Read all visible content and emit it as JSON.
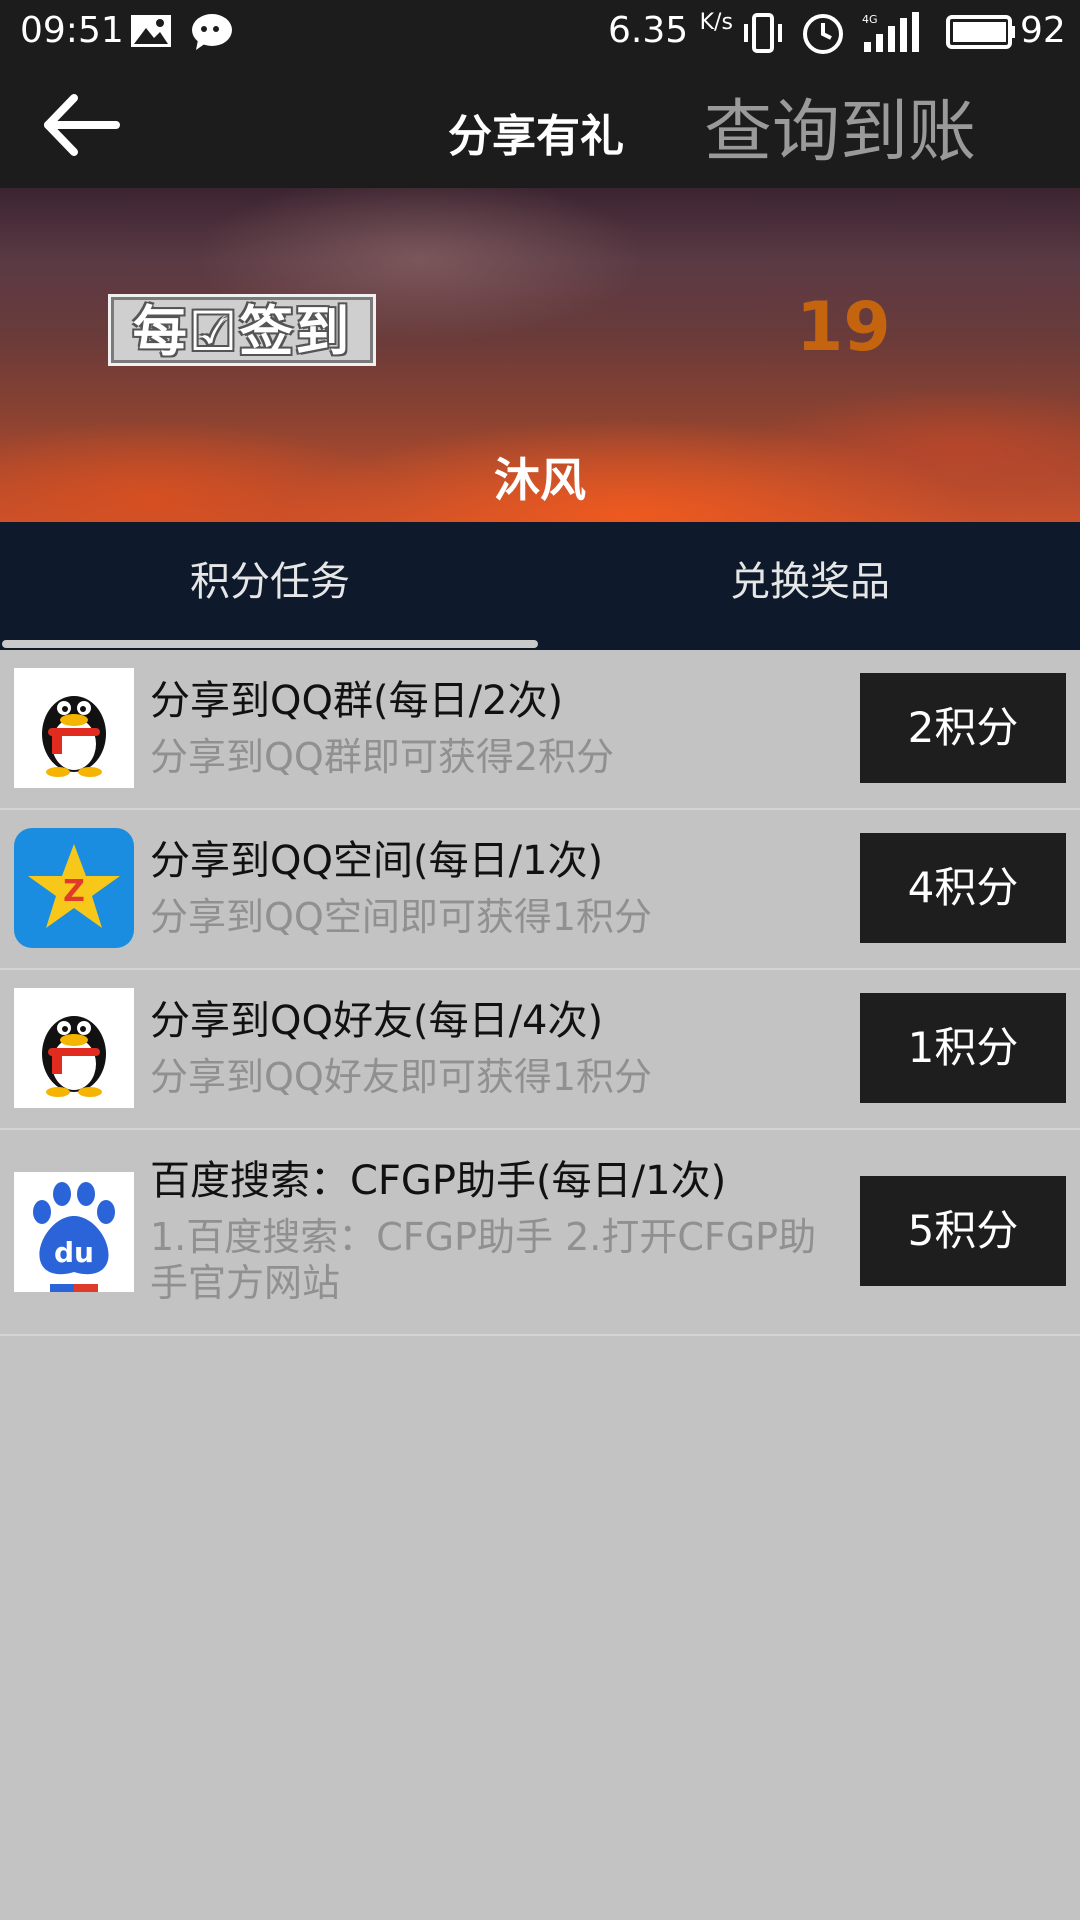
{
  "status_bar": {
    "time": "09:51",
    "speed": "6.35",
    "speed_unit": "K/s",
    "network": "4G",
    "battery": "92"
  },
  "header": {
    "title": "分享有礼",
    "query_link": "查询到账"
  },
  "banner": {
    "sign_in_label": "每☑签到",
    "points": "19",
    "username": "沐风"
  },
  "tabs": [
    {
      "label": "积分任务",
      "active": true
    },
    {
      "label": "兑换奖品",
      "active": false
    }
  ],
  "tasks": [
    {
      "icon": "qq-penguin-icon",
      "title": "分享到QQ群(每日/2次)",
      "desc": "分享到QQ群即可获得2积分",
      "button": "2积分"
    },
    {
      "icon": "qzone-star-icon",
      "title": "分享到QQ空间(每日/1次)",
      "desc": "分享到QQ空间即可获得1积分",
      "button": "4积分"
    },
    {
      "icon": "qq-penguin-icon",
      "title": "分享到QQ好友(每日/4次)",
      "desc": "分享到QQ好友即可获得1积分",
      "button": "1积分"
    },
    {
      "icon": "baidu-paw-icon",
      "title": "百度搜索：CFGP助手(每日/1次)",
      "desc": "1.百度搜索：CFGP助手  2.打开CFGP助手官方网站",
      "button": "5积分"
    }
  ],
  "colors": {
    "bar": "#1c1c1c",
    "tabs": "#0e1a2c",
    "points": "#c5640e",
    "page_bg": "#c3c3c3"
  }
}
